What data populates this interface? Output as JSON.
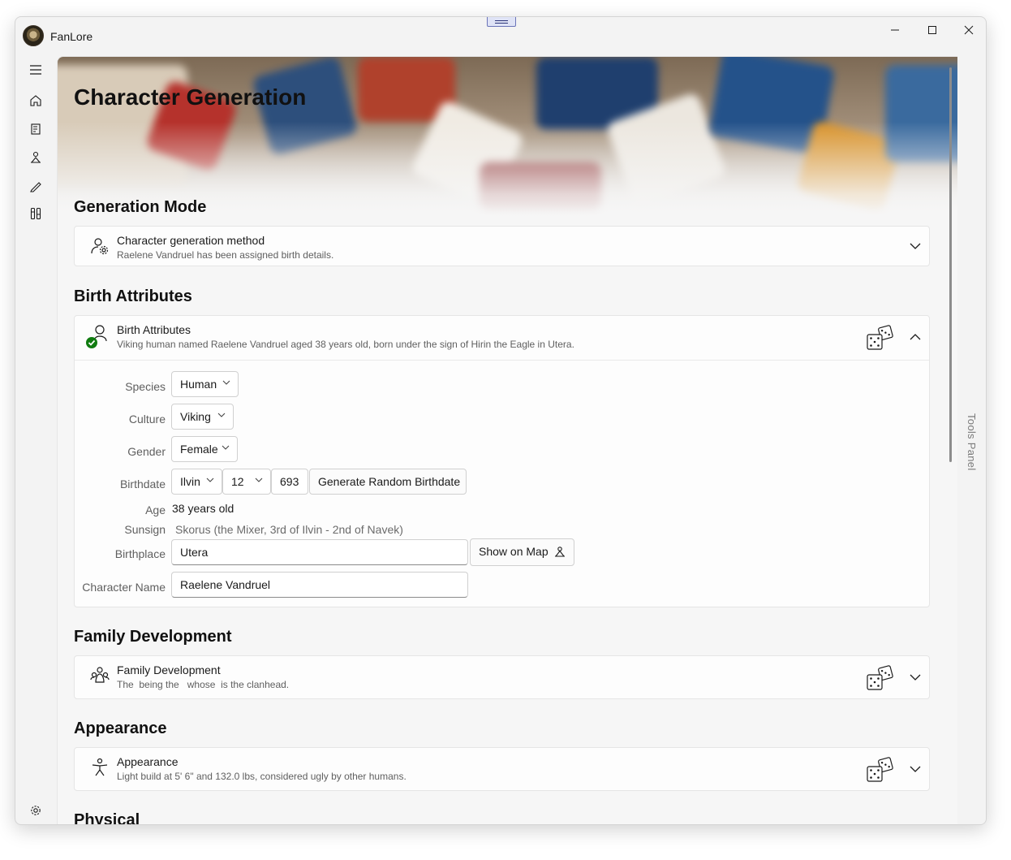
{
  "app": {
    "title": "FanLore"
  },
  "nav": {
    "items": [
      "menu-icon",
      "home-icon",
      "notebook-icon",
      "character-icon",
      "pen-icon",
      "tools-icon",
      "gear-icon"
    ]
  },
  "page": {
    "title": "Character Generation"
  },
  "sections": {
    "generation_mode": {
      "heading": "Generation Mode",
      "card_title": "Character generation method",
      "card_desc": "Raelene Vandruel has been assigned birth details."
    },
    "birth_attributes": {
      "heading": "Birth Attributes",
      "card_title": "Birth Attributes",
      "card_desc": "Viking human named Raelene Vandruel aged 38 years old, born under the sign of Hirin the Eagle in Utera.",
      "fields": {
        "species_label": "Species",
        "species_value": "Human",
        "culture_label": "Culture",
        "culture_value": "Viking",
        "gender_label": "Gender",
        "gender_value": "Female",
        "birthdate_label": "Birthdate",
        "birth_month": "Ilvin",
        "birth_day": "12",
        "birth_year": "693",
        "random_birthdate_button": "Generate Random Birthdate",
        "age_label": "Age",
        "age_value": "38 years old",
        "sunsign_label": "Sunsign",
        "sunsign_value": "Skorus (the Mixer, 3rd of Ilvin - 2nd of Navek)",
        "birthplace_label": "Birthplace",
        "birthplace_value": "Utera",
        "show_on_map_button": "Show on Map",
        "name_label": "Character Name",
        "name_value": "Raelene Vandruel"
      }
    },
    "family_development": {
      "heading": "Family Development",
      "card_title": "Family Development",
      "card_desc": "The  being the   whose  is the clanhead."
    },
    "appearance": {
      "heading": "Appearance",
      "card_title": "Appearance",
      "card_desc": "Light build at 5' 6\" and 132.0 lbs, considered ugly by other humans."
    },
    "physical": {
      "heading": "Physical"
    }
  },
  "tools_panel": {
    "label": "Tools Panel"
  },
  "colors": {
    "accent_check": "#107c10"
  }
}
